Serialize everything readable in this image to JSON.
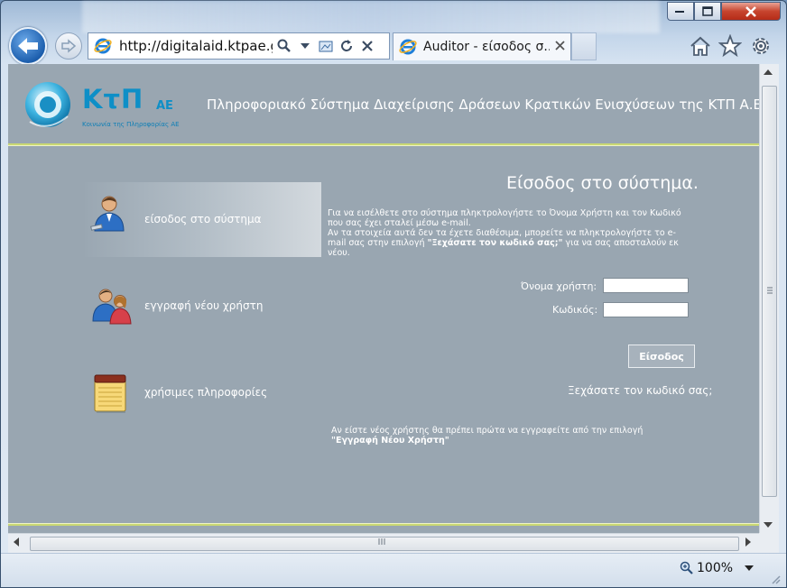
{
  "browser": {
    "address": "http://digitalaid.ktpae.gr/",
    "tab_title": "Auditor - είσοδος σ...",
    "zoom": "100%",
    "icons": [
      "back-arrow-icon",
      "forward-arrow-icon",
      "ie-logo-icon",
      "search-icon",
      "dropdown-icon",
      "compat-view-icon",
      "refresh-icon",
      "stop-icon",
      "close-tab-icon",
      "home-icon",
      "favorites-star-icon",
      "tools-gear-icon",
      "zoom-icon"
    ]
  },
  "header": {
    "logo_text": "ΚτΠ",
    "logo_suffix": "ΑΕ",
    "logo_subtitle": "Κοινωνία της Πληροφορίας ΑΕ",
    "title": "Πληροφοριακό Σύστημα Διαχείρισης Δράσεων Κρατικών Ενισχύσεων της ΚΤΠ Α.Ε."
  },
  "menu": {
    "items": [
      {
        "label": "είσοδος στο σύστημα",
        "icon": "user-icon",
        "active": true
      },
      {
        "label": "εγγραφή νέου χρήστη",
        "icon": "users-icon",
        "active": false
      },
      {
        "label": "χρήσιμες πληροφορίες",
        "icon": "notepad-icon",
        "active": false
      }
    ]
  },
  "login": {
    "heading": "Είσοδος στο σύστημα.",
    "intro_1": "Για να εισέλθετε στο σύστημα πληκτρολογήστε το Όνομα Χρήστη και τον Κωδικό που σας έχει σταλεί μέσω e-mail.",
    "intro_2": "Αν τα στοιχεία αυτά δεν τα έχετε διαθέσιμα, μπορείτε να πληκτρολογήστε το e-mail σας στην επιλογή ",
    "intro_2_bold": "\"Ξεχάσατε τον κωδικό σας;\"",
    "intro_2_end": " για να σας αποσταλούν εκ νέου.",
    "username_label": "Όνομα χρήστη:",
    "username_value": "",
    "password_label": "Κωδικός:",
    "password_value": "",
    "button_label": "Είσοδος",
    "forgot_label": "Ξεχάσατε τον κωδικό σας;",
    "register_note": "Αν είστε νέος χρήστης θα πρέπει πρώτα να εγγραφείτε από την επιλογή ",
    "register_note_bold": "\"Εγγραφή Νέου Χρήστη\""
  }
}
